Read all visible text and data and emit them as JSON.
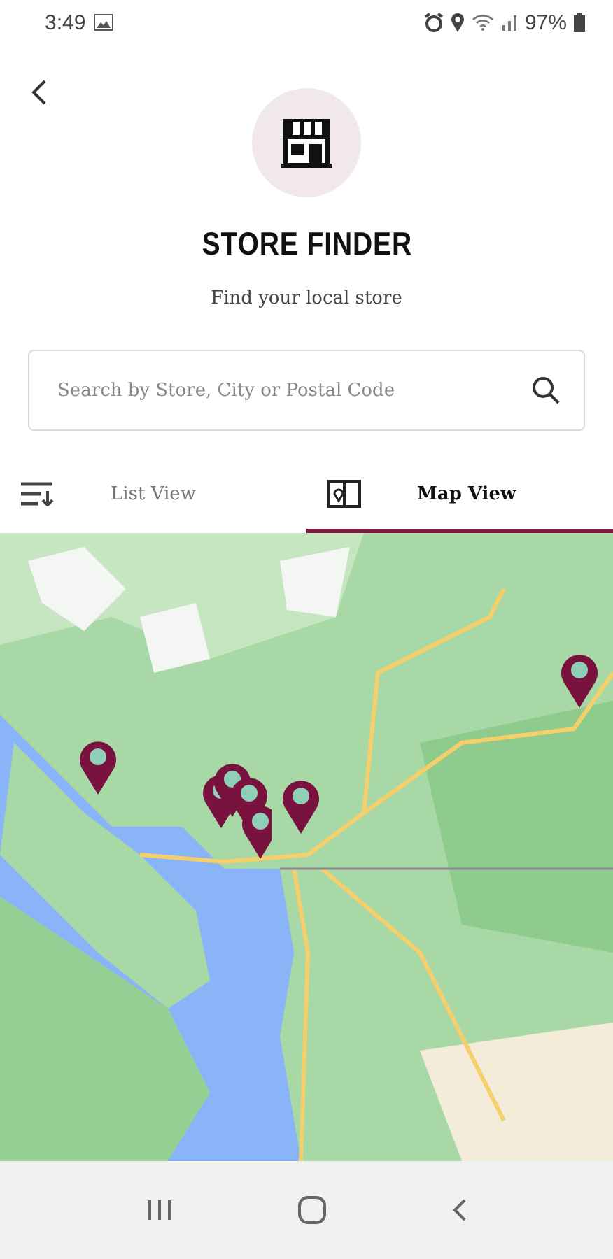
{
  "status_bar": {
    "time": "3:49",
    "battery": "97%"
  },
  "header": {
    "title": "STORE FINDER",
    "subtitle": "Find your local store"
  },
  "search": {
    "placeholder": "Search by Store, City or Postal Code"
  },
  "tabs": [
    {
      "label": "List View",
      "kind": "list",
      "selected": false
    },
    {
      "label": "Map View",
      "kind": "map",
      "selected": true
    }
  ]
}
